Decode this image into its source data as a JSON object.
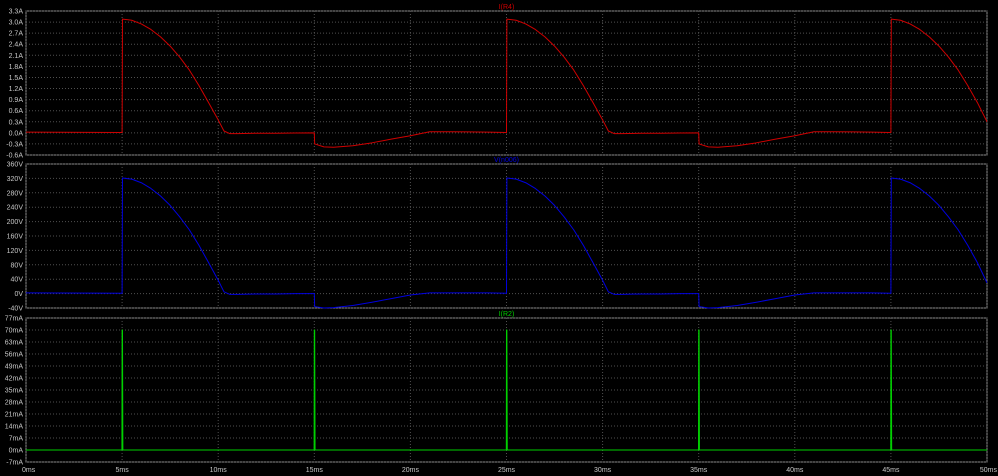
{
  "chart_data": [
    {
      "type": "line",
      "title": "I(R4)",
      "color": "#d00000",
      "x_unit": "ms",
      "xlim": [
        0,
        50
      ],
      "ylim": [
        -0.6,
        3.3
      ],
      "yticks": [
        3.3,
        3.0,
        2.7,
        2.4,
        2.1,
        1.8,
        1.5,
        1.2,
        0.9,
        0.6,
        0.3,
        0.0,
        -0.3,
        -0.6
      ],
      "ytick_labels": [
        "3.3A",
        "3.0A",
        "2.7A",
        "2.4A",
        "2.1A",
        "1.8A",
        "1.5A",
        "1.2A",
        "0.9A",
        "0.6A",
        "0.3A",
        "0.0A",
        "-0.3A",
        "-0.6A"
      ],
      "grid": true,
      "series": [
        {
          "x": [
            0,
            5,
            5.02,
            5.5,
            6,
            6.5,
            7,
            7.5,
            8,
            8.5,
            9,
            9.5,
            10,
            10.3,
            10.6,
            11,
            12,
            13,
            14,
            15,
            15.02,
            15.5,
            16,
            17,
            18,
            19,
            20,
            21,
            22,
            23,
            24,
            25,
            25.02,
            25.5,
            26,
            26.5,
            27,
            27.5,
            28,
            28.5,
            29,
            29.5,
            30,
            30.3,
            30.6,
            31,
            32,
            33,
            34,
            35,
            35.02,
            35.5,
            36,
            37,
            38,
            39,
            40,
            41,
            42,
            43,
            44,
            45,
            45.02,
            45.5,
            46,
            46.5,
            47,
            47.5,
            48,
            48.5,
            49,
            49.5,
            50
          ],
          "y": [
            0.02,
            0.01,
            3.08,
            3.05,
            2.95,
            2.8,
            2.6,
            2.35,
            2.05,
            1.7,
            1.28,
            0.82,
            0.35,
            0.05,
            -0.02,
            -0.02,
            -0.01,
            -0.01,
            -0.005,
            0.0,
            -0.3,
            -0.38,
            -0.39,
            -0.35,
            -0.27,
            -0.17,
            -0.08,
            0.03,
            0.03,
            0.025,
            0.02,
            0.01,
            3.08,
            3.05,
            2.95,
            2.8,
            2.6,
            2.35,
            2.05,
            1.7,
            1.28,
            0.82,
            0.35,
            0.05,
            -0.02,
            -0.02,
            -0.01,
            -0.01,
            -0.005,
            0.0,
            -0.3,
            -0.38,
            -0.39,
            -0.35,
            -0.27,
            -0.17,
            -0.08,
            0.03,
            0.03,
            0.025,
            0.02,
            0.01,
            3.08,
            3.05,
            2.95,
            2.8,
            2.6,
            2.35,
            2.05,
            1.7,
            1.28,
            0.82,
            0.3
          ]
        }
      ]
    },
    {
      "type": "line",
      "title": "V(n006)",
      "color": "#0000e0",
      "x_unit": "ms",
      "xlim": [
        0,
        50
      ],
      "ylim": [
        -40,
        360
      ],
      "yticks": [
        360,
        320,
        280,
        240,
        200,
        160,
        120,
        80,
        40,
        0,
        -40
      ],
      "ytick_labels": [
        "360V",
        "320V",
        "280V",
        "240V",
        "200V",
        "160V",
        "120V",
        "80V",
        "40V",
        "0V",
        "-40V"
      ],
      "grid": true,
      "series": [
        {
          "x": [
            0,
            5,
            5.02,
            5.5,
            6,
            6.5,
            7,
            7.5,
            8,
            8.5,
            9,
            9.5,
            10,
            10.3,
            10.6,
            11,
            12,
            13,
            14,
            15,
            15.02,
            15.5,
            16,
            17,
            18,
            19,
            20,
            21,
            22,
            23,
            24,
            25,
            25.02,
            25.5,
            26,
            26.5,
            27,
            27.5,
            28,
            28.5,
            29,
            29.5,
            30,
            30.3,
            30.6,
            31,
            32,
            33,
            34,
            35,
            35.02,
            35.5,
            36,
            37,
            38,
            39,
            40,
            41,
            42,
            43,
            44,
            45,
            45.02,
            45.5,
            46,
            46.5,
            47,
            47.5,
            48,
            48.5,
            49,
            49.5,
            50
          ],
          "y": [
            2,
            1,
            321,
            318,
            308,
            292,
            271,
            245,
            213,
            177,
            134,
            86,
            37,
            5,
            -2,
            -2,
            -1,
            -1,
            0,
            0,
            -36,
            -40,
            -39,
            -33,
            -24,
            -14,
            -4,
            2,
            2,
            2,
            2,
            1,
            321,
            318,
            308,
            292,
            271,
            245,
            213,
            177,
            134,
            86,
            37,
            5,
            -2,
            -2,
            -1,
            -1,
            0,
            0,
            -36,
            -40,
            -39,
            -33,
            -24,
            -14,
            -4,
            2,
            2,
            2,
            2,
            1,
            321,
            318,
            308,
            292,
            271,
            245,
            213,
            177,
            134,
            86,
            30
          ]
        }
      ]
    },
    {
      "type": "line",
      "title": "I(R2)",
      "color": "#00d000",
      "x_unit": "ms",
      "xlim": [
        0,
        50
      ],
      "ylim": [
        -7,
        77
      ],
      "yticks": [
        77,
        70,
        63,
        56,
        49,
        42,
        35,
        28,
        21,
        14,
        7,
        0,
        -7
      ],
      "ytick_labels": [
        "77mA",
        "70mA",
        "63mA",
        "56mA",
        "49mA",
        "42mA",
        "35mA",
        "28mA",
        "21mA",
        "14mA",
        "7mA",
        "0mA",
        "-7mA"
      ],
      "grid": true,
      "series": [
        {
          "x": [
            0,
            4.99,
            5,
            5.02,
            5.04,
            14.99,
            15,
            15.02,
            15.04,
            24.99,
            25,
            25.02,
            25.04,
            34.99,
            35,
            35.02,
            35.04,
            44.99,
            45,
            45.02,
            45.04,
            50
          ],
          "y": [
            0,
            0,
            70,
            70,
            0,
            0,
            70,
            70,
            0,
            0,
            70,
            70,
            0,
            0,
            70,
            70,
            0,
            0,
            70,
            70,
            0,
            0
          ]
        }
      ]
    }
  ],
  "x_ticks": [
    0,
    5,
    10,
    15,
    20,
    25,
    30,
    35,
    40,
    45,
    50
  ],
  "x_tick_labels": [
    "0ms",
    "5ms",
    "10ms",
    "15ms",
    "20ms",
    "25ms",
    "30ms",
    "35ms",
    "40ms",
    "45ms",
    "50ms"
  ],
  "colors": {
    "background": "#000000",
    "grid": "#505050",
    "frame": "#8a8a8a",
    "tick_text": "#c8c8c8"
  }
}
